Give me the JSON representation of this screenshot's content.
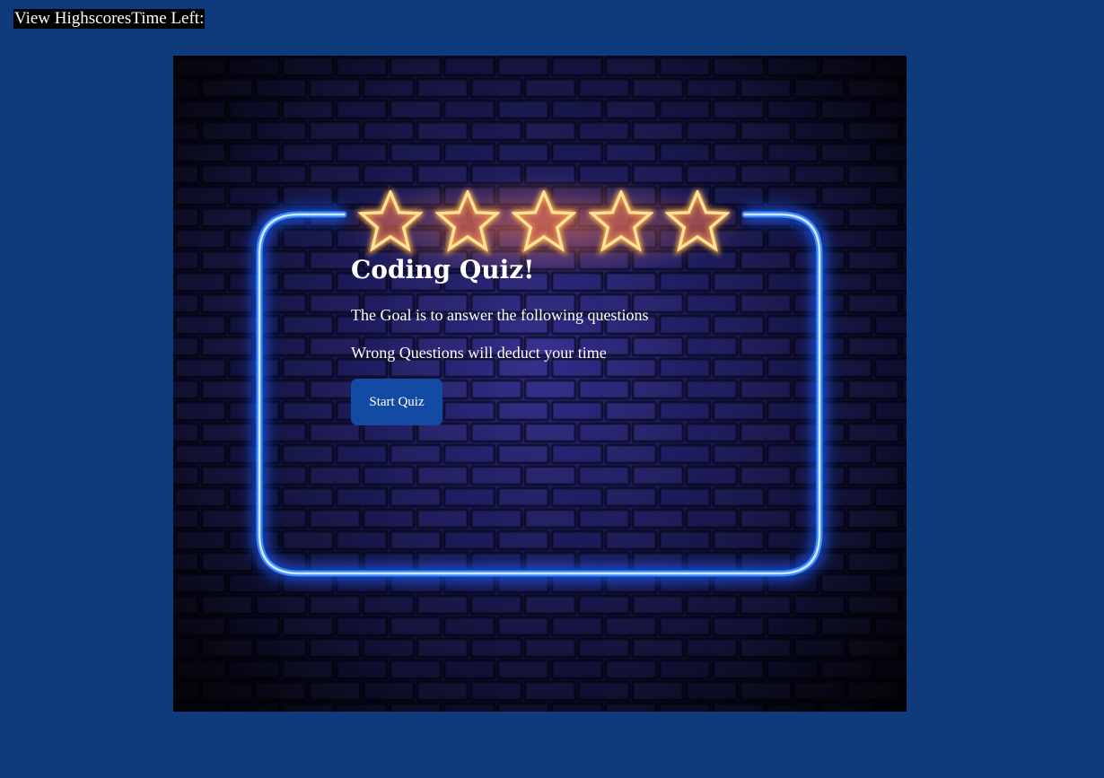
{
  "header": {
    "highscores_link": "View Highscores",
    "time_label": "Time Left:"
  },
  "quiz": {
    "title": "Coding Quiz!",
    "line1": "The Goal is to answer the following questions",
    "line2": "Wrong Questions will deduct your time",
    "start_button": "Start Quiz"
  },
  "background": {
    "rating_stars": 5,
    "neon_color": "#3a8bff",
    "star_color": "#ffd36a",
    "page_color": "#0f3a7b"
  }
}
